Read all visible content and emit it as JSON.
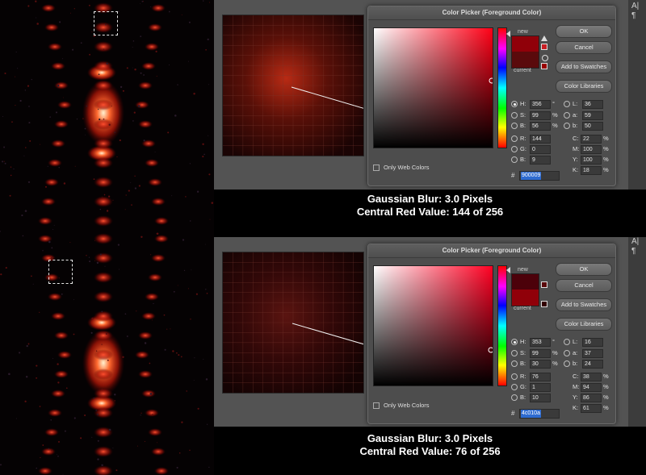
{
  "dialog_title": "Color Picker (Foreground Color)",
  "buttons": {
    "ok": "OK",
    "cancel": "Cancel",
    "add_to_swatches": "Add to Swatches",
    "color_libraries": "Color Libraries"
  },
  "labels": {
    "new": "new",
    "current": "current",
    "only_web_colors": "Only Web Colors",
    "hex_symbol": "#"
  },
  "panels": [
    {
      "fields": {
        "H": "356",
        "H_unit": "°",
        "S": "99",
        "S_unit": "%",
        "B": "56",
        "B_unit": "%",
        "R": "144",
        "G": "0",
        "Bv": "9",
        "L": "36",
        "a": "59",
        "b": "50",
        "C": "22",
        "M": "100",
        "Y": "100",
        "K": "18"
      },
      "hex": "900009",
      "colors": {
        "new": "#900009",
        "current": "#5a0a0c",
        "field_hue": "#ff0016",
        "canvas_center": "#902010"
      },
      "caption_line1": "Gaussian Blur: 3.0 Pixels",
      "caption_line2": "Central Red Value: 144 of 256"
    },
    {
      "fields": {
        "H": "353",
        "H_unit": "°",
        "S": "99",
        "S_unit": "%",
        "B": "30",
        "B_unit": "%",
        "R": "76",
        "G": "1",
        "Bv": "10",
        "L": "16",
        "a": "37",
        "b": "24",
        "C": "38",
        "M": "94",
        "Y": "86",
        "K": "61"
      },
      "hex": "4c010a",
      "colors": {
        "new": "#4c010a",
        "current": "#900009",
        "field_hue": "#ff0022",
        "canvas_center": "#4c0a0a"
      },
      "caption_line1": "Gaussian Blur: 3.0 Pixels",
      "caption_line2": "Central Red Value: 76 of 256"
    }
  ],
  "rightbar_glyphs": [
    "A|",
    "¶"
  ]
}
